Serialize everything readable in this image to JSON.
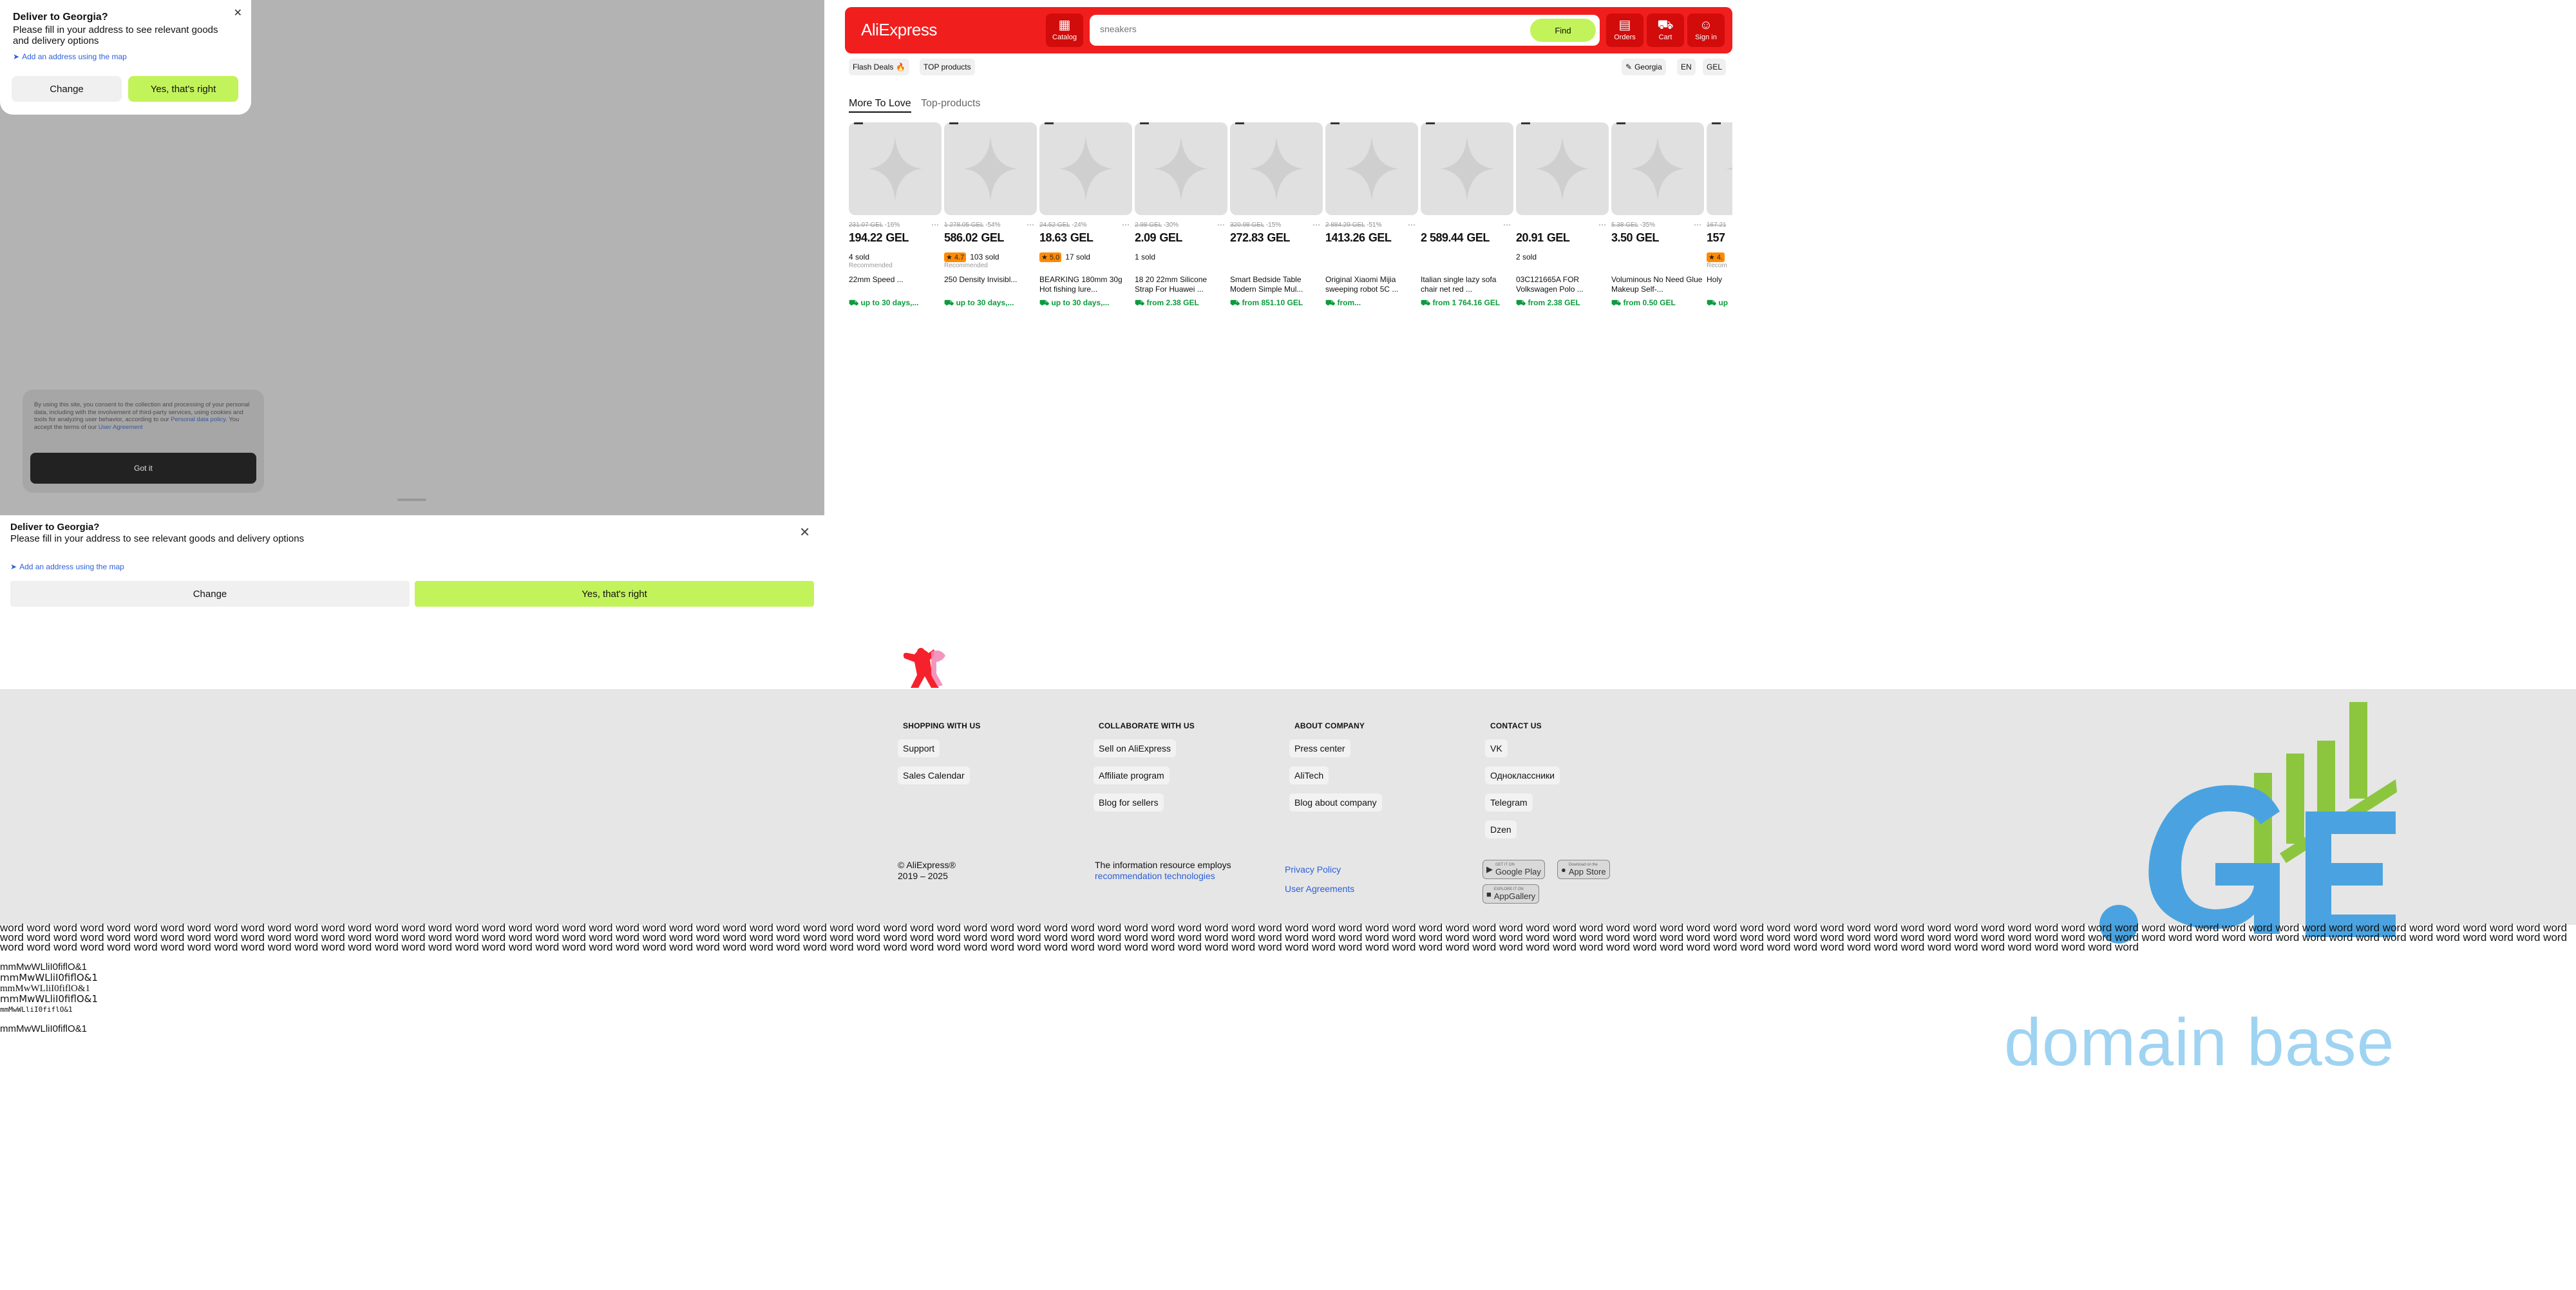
{
  "popup": {
    "title": "Deliver to Georgia?",
    "description": "Please fill in your address to see relevant goods and delivery options",
    "map_link": "Add an address using the map",
    "change": "Change",
    "confirm": "Yes, that's right"
  },
  "cookie": {
    "text": "By using this site, you consent to the collection and processing of your personal data, including with the involvement of third-party services, using cookies and tools for analyzing user behavior, according to our ",
    "link1": "Personal data policy",
    "text2": ". You accept the terms of our ",
    "link2": "User Agreement",
    "button": "Got it"
  },
  "header": {
    "logo": "AliExpress",
    "catalog": "Catalog",
    "search_placeholder": "sneakers",
    "find": "Find",
    "orders": "Orders",
    "cart": "Cart",
    "sign_in": "Sign in"
  },
  "subheader": {
    "flash_deals": "Flash Deals",
    "top_products": "TOP products",
    "region": "Georgia",
    "lang": "EN",
    "currency": "GEL"
  },
  "tabs": [
    "More To Love",
    "Top-products"
  ],
  "products": [
    {
      "old": "231.07 GEL",
      "disc": "-16%",
      "price": "194.22",
      "cur": "GEL",
      "rating": "",
      "sold": "4 sold",
      "rec": "Recommended",
      "name": "22mm Speed ...",
      "delivery": "up to 30 days,..."
    },
    {
      "old": "1 278.05 GEL",
      "disc": "-54%",
      "price": "586.02",
      "cur": "GEL",
      "rating": "4.7",
      "sold": "103 sold",
      "rec": "Recommended",
      "name": "250 Density Invisibl...",
      "delivery": "up to 30 days,..."
    },
    {
      "old": "24.52 GEL",
      "disc": "-24%",
      "price": "18.63",
      "cur": "GEL",
      "rating": "5.0",
      "sold": "17 sold",
      "rec": "",
      "name": "BEARKING 180mm 30g Hot fishing lure...",
      "delivery": "up to 30 days,..."
    },
    {
      "old": "2.98 GEL",
      "disc": "-30%",
      "price": "2.09",
      "cur": "GEL",
      "rating": "",
      "sold": "1 sold",
      "rec": "",
      "name": "18 20 22mm Silicone Strap For Huawei ...",
      "delivery": "from 2.38 GEL"
    },
    {
      "old": "320.98 GEL",
      "disc": "-15%",
      "price": "272.83",
      "cur": "GEL",
      "rating": "",
      "sold": "",
      "rec": "",
      "name": "Smart Bedside Table Modern Simple Mul...",
      "delivery": "from 851.10 GEL"
    },
    {
      "old": "2 884.29 GEL",
      "disc": "-51%",
      "price": "1413.26",
      "cur": "GEL",
      "rating": "",
      "sold": "",
      "rec": "",
      "name": "Original Xiaomi Mijia sweeping robot 5C ...",
      "delivery": "from..."
    },
    {
      "old": "",
      "disc": "",
      "price": "2 589.44",
      "cur": "GEL",
      "rating": "",
      "sold": "",
      "rec": "",
      "name": "Italian single lazy sofa chair net red ...",
      "delivery": "from 1 764.16 GEL"
    },
    {
      "old": "",
      "disc": "",
      "price": "20.91",
      "cur": "GEL",
      "rating": "",
      "sold": "2 sold",
      "rec": "",
      "name": "03C121665A FOR Volkswagen Polo ...",
      "delivery": "from 2.38 GEL"
    },
    {
      "old": "5.38 GEL",
      "disc": "-35%",
      "price": "3.50",
      "cur": "GEL",
      "rating": "",
      "sold": "",
      "rec": "",
      "name": "Voluminous No Need Glue Makeup Self-...",
      "delivery": "from 0.50 GEL"
    },
    {
      "old": "167.21",
      "disc": "",
      "price": "157",
      "cur": "",
      "rating": "4.",
      "sold": "",
      "rec": "Recom",
      "name": "Holy",
      "delivery": "up"
    }
  ],
  "footer": {
    "columns": [
      {
        "heading": "SHOPPING WITH US",
        "items": [
          "Support",
          "Sales Calendar"
        ]
      },
      {
        "heading": "COLLABORATE WITH US",
        "items": [
          "Sell on AliExpress",
          "Affiliate program",
          "Blog for sellers"
        ]
      },
      {
        "heading": "ABOUT COMPANY",
        "items": [
          "Press center",
          "AliTech",
          "Blog about company"
        ]
      },
      {
        "heading": "CONTACT US",
        "items": [
          "VK",
          "Одноклассники",
          "Telegram",
          "Dzen"
        ]
      }
    ],
    "copyright": "© AliExpress®",
    "years": "2019 – 2025",
    "info": "The information resource employs",
    "info_link": "recommendation technologies",
    "privacy": "Privacy Policy",
    "agreements": "User Agreements",
    "stores": [
      {
        "small": "GET IT ON",
        "label": "Google Play"
      },
      {
        "small": "Download on the",
        "label": "App Store"
      },
      {
        "small": "EXPLORE IT ON",
        "label": "AppGallery"
      }
    ]
  },
  "ge_logo": {
    "domain": "domain base"
  },
  "debug": {
    "words": "word word word word word word word word word word word word word word word word word word word word word word word word word word word word word word word word word word word word word word word word word word word word word word word word word word word word word word word word word word word word word word word word word word word word word word word word word word word word word word word word word word word word word word word word word word word word word word word word word word word word word word word word word word word word word word word word word word word word word word word word word word word word word word word word word word word word word word word word word word word word word word word word word word word word word word word word word word word word word word word word word word word word word word word word word word word word word word word word word word word word word word word word word word word word word word word word word word word word word word word word word word word word word word word word word word word word word word word word word word word word word word word word word word word word word word word word word word word word word word word word word word word word word word word word word word word word word word word word word word word word word word word word word word word word word word word word",
    "font_tests": [
      "mmMwWLliI0fiflO&1",
      "mmMwWLliI0fiflO&1",
      "mmMwWLliI0fiflO&1",
      "mmMwWLliI0fiflO&1",
      "mmMwWLliI0fiflO&1",
      "mmMwWLliI0fiflO&1"
    ]
  },
  "colors": {
    "brand_red": "#f11e1e",
    "accent_green": "#c3f35a",
    "link_blue": "#2b5fd9",
    "delivery_green": "#0c9b3d",
    "ge_blue": "#4aa3e0",
    "ge_green": "#8cc63f"
  }
}
